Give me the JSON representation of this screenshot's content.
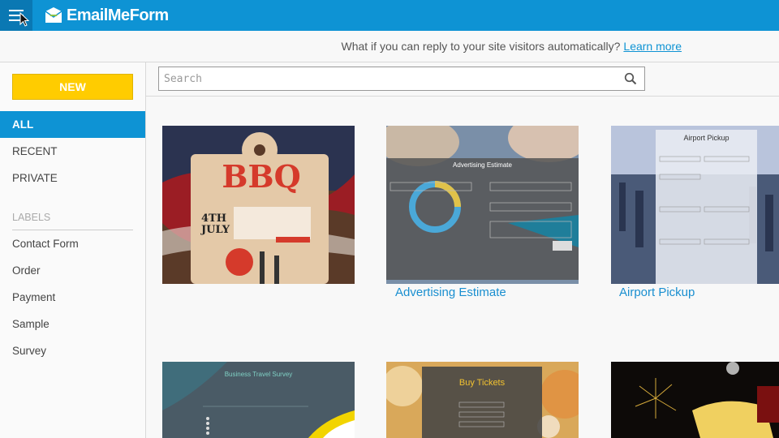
{
  "header": {
    "brand": "EmailMeForm",
    "menu_icon": "hamburger-icon"
  },
  "promo": {
    "text": "What if you can reply to your site visitors automatically?",
    "link": "Learn more"
  },
  "sidebar": {
    "new_label": "NEW",
    "nav": [
      "ALL",
      "RECENT",
      "PRIVATE"
    ],
    "labels_heading": "LABELS",
    "labels": [
      "Contact Form",
      "Order",
      "Payment",
      "Sample",
      "Survey"
    ]
  },
  "search": {
    "placeholder": "Search",
    "icon": "search-icon"
  },
  "templates": [
    {
      "title": "",
      "thumb_texts": [
        "BBQ",
        "4TH JULY"
      ]
    },
    {
      "title": "Advertising Estimate",
      "thumb_texts": [
        "Advertising Estimate"
      ]
    },
    {
      "title": "Airport Pickup",
      "thumb_texts": [
        "Airport Pickup"
      ]
    },
    {
      "title": "",
      "thumb_texts": [
        "Business Travel Survey"
      ]
    },
    {
      "title": "",
      "thumb_texts": [
        "Buy Tickets"
      ]
    },
    {
      "title": "",
      "thumb_texts": []
    }
  ],
  "colors": {
    "brand_blue": "#0e93d4",
    "new_yellow": "#ffcc00",
    "link_blue": "#1a8fd0"
  }
}
